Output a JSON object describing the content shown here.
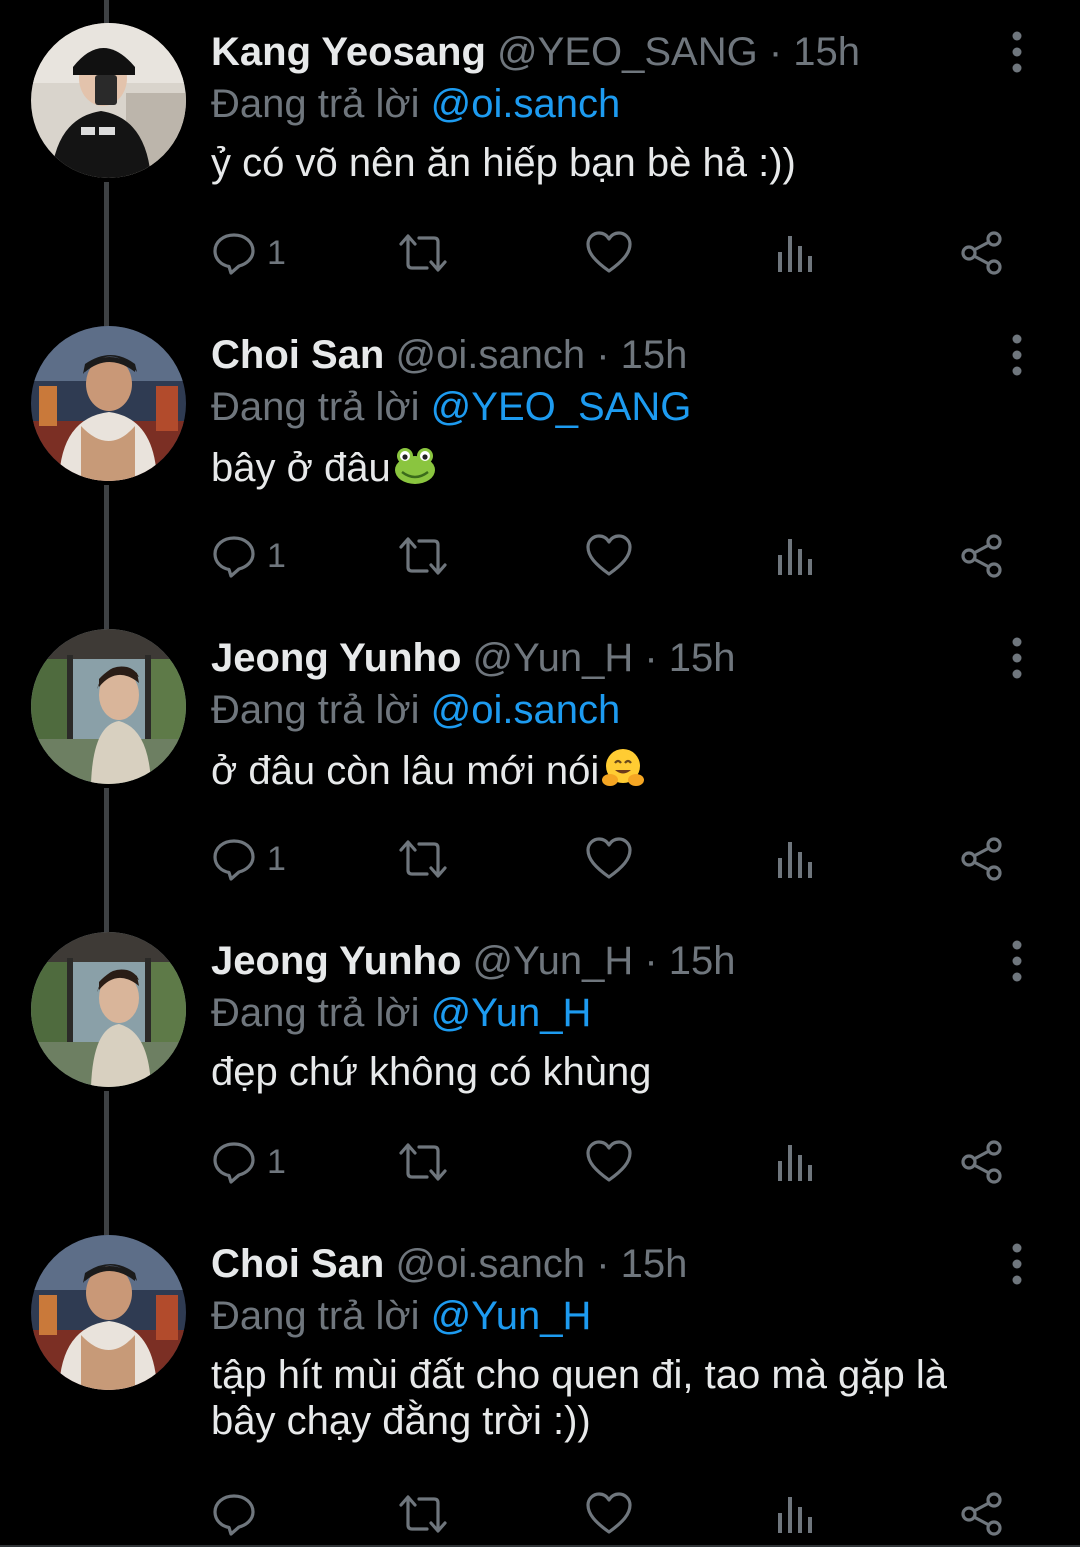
{
  "colors": {
    "background": "#000000",
    "primary_text": "#e7e9ea",
    "secondary_text": "#6f767d",
    "mention": "#1d9bf0",
    "thread_line": "#3e4144"
  },
  "reply_prefix": "Đang trả lời",
  "tweets": [
    {
      "display_name": "Kang Yeosang",
      "handle": "@YEO_SANG",
      "separator": "·",
      "time": "15h",
      "reply_prefix": "Đang trả lời",
      "reply_to": "@oi.sanch",
      "text": "ỷ có võ nên ăn hiếp bạn bè hả :))",
      "emoji": "",
      "reply_count": "1",
      "avatar": "kang-yeosang-avatar"
    },
    {
      "display_name": "Choi San",
      "handle": "@oi.sanch",
      "separator": "·",
      "time": "15h",
      "reply_prefix": "Đang trả lời",
      "reply_to": "@YEO_SANG",
      "text": "bây ở đâu",
      "emoji": "frog-emoji",
      "reply_count": "1",
      "avatar": "choi-san-avatar"
    },
    {
      "display_name": "Jeong Yunho",
      "handle": "@Yun_H",
      "separator": "·",
      "time": "15h",
      "reply_prefix": "Đang trả lời",
      "reply_to": "@oi.sanch",
      "text": "ở đâu còn lâu mới nói",
      "emoji": "hugging-face-emoji",
      "reply_count": "1",
      "avatar": "jeong-yunho-avatar"
    },
    {
      "display_name": "Jeong Yunho",
      "handle": "@Yun_H",
      "separator": "·",
      "time": "15h",
      "reply_prefix": "Đang trả lời",
      "reply_to": "@Yun_H",
      "text": "đẹp chứ không có khùng",
      "emoji": "",
      "reply_count": "1",
      "avatar": "jeong-yunho-avatar"
    },
    {
      "display_name": "Choi San",
      "handle": "@oi.sanch",
      "separator": "·",
      "time": "15h",
      "reply_prefix": "Đang trả lời",
      "reply_to": "@Yun_H",
      "text": "tập hít mùi đất cho quen đi, tao mà gặp là bây chạy đằng trời :))",
      "emoji": "",
      "reply_count": "",
      "avatar": "choi-san-avatar"
    }
  ],
  "action_icons": [
    "reply-icon",
    "retweet-icon",
    "like-icon",
    "views-icon",
    "share-icon"
  ]
}
